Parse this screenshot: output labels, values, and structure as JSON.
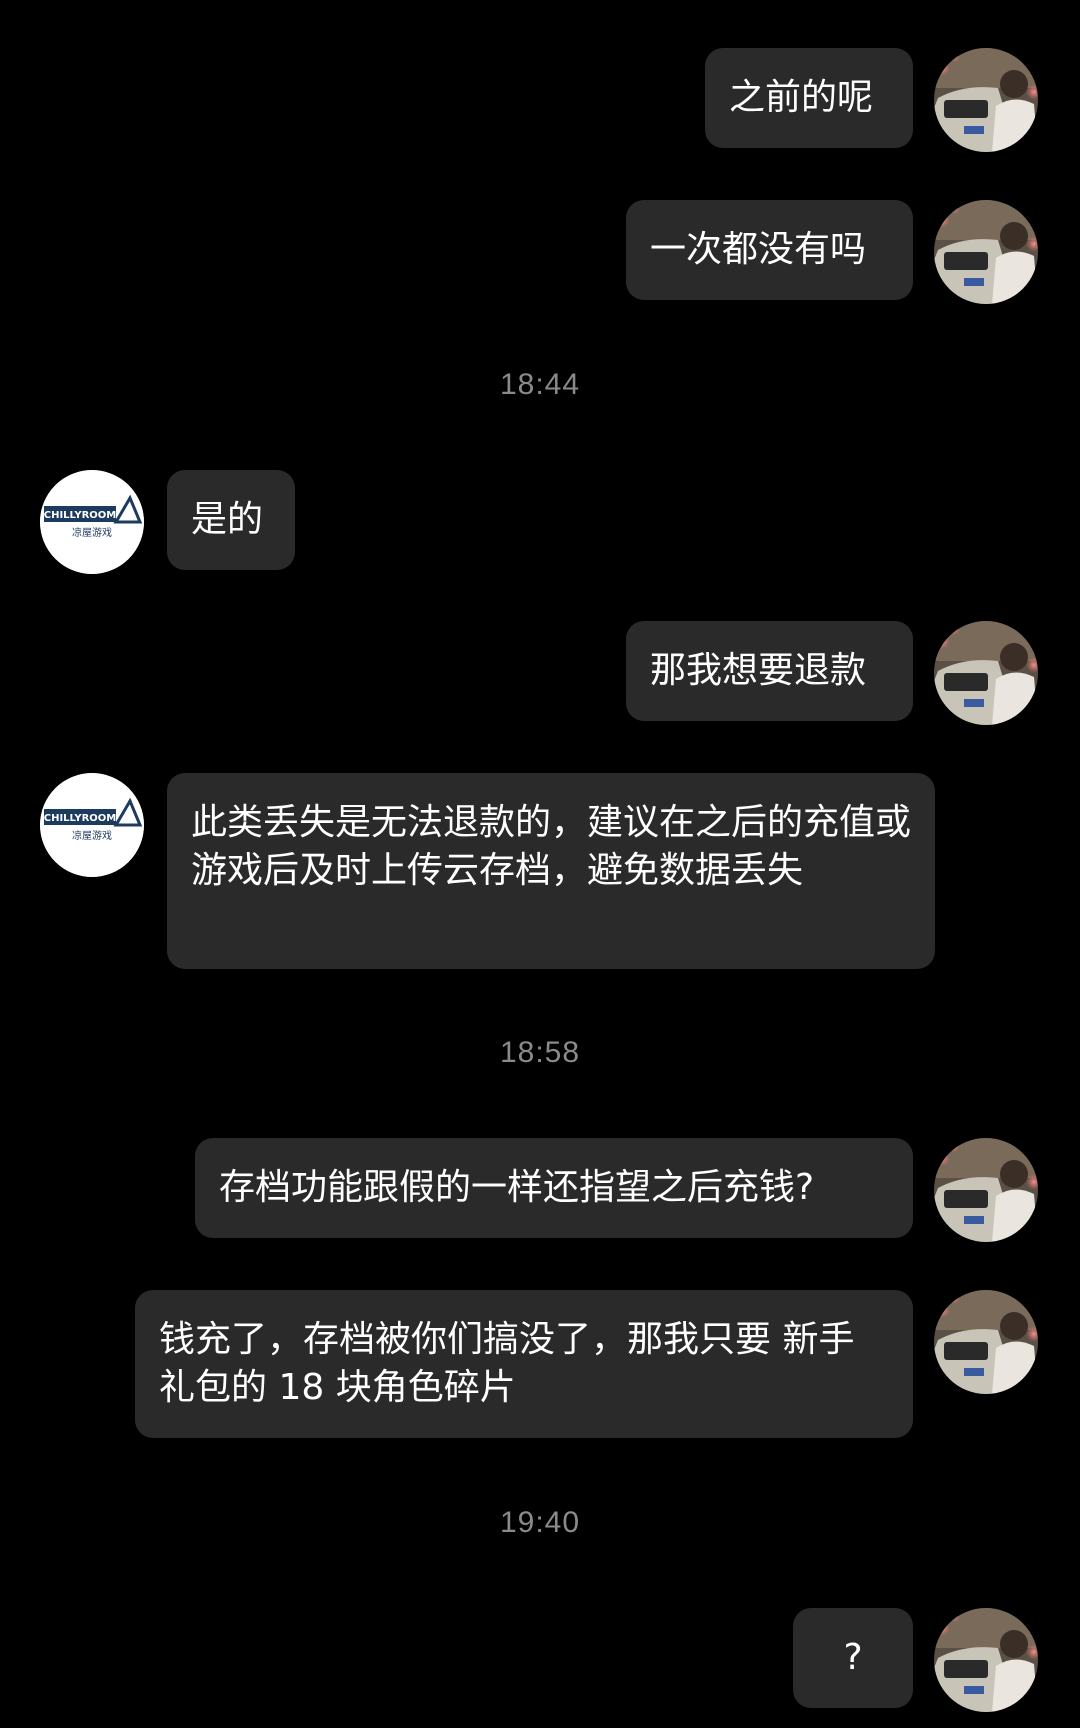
{
  "colors": {
    "background": "#000000",
    "bubble": "#2a2a2a",
    "text": "#ffffff",
    "timestamp": "#8a8a8a",
    "support_logo_navy": "#1d3a5f"
  },
  "avatars": {
    "user_icon": "user-photo-avatar",
    "support_icon": "chillyroom-logo-avatar",
    "support_logo_text": "CHILLYROOM",
    "support_logo_subtext": "凉屋游戏"
  },
  "messages": [
    {
      "sender": "user",
      "text": "之前的呢"
    },
    {
      "sender": "user",
      "text": "一次都没有吗"
    },
    {
      "type": "time",
      "text": "18:44"
    },
    {
      "sender": "support",
      "text": "是的"
    },
    {
      "sender": "user",
      "text": "那我想要退款"
    },
    {
      "sender": "support",
      "text": "此类丢失是无法退款的，建议在之后的充值或游戏后及时上传云存档，避免数据丢失"
    },
    {
      "type": "time",
      "text": "18:58"
    },
    {
      "sender": "user",
      "text": "存档功能跟假的一样还指望之后充钱?"
    },
    {
      "sender": "user",
      "text": "钱充了，存档被你们搞没了，那我只要 新手礼包的 18 块角色碎片"
    },
    {
      "type": "time",
      "text": "19:40"
    },
    {
      "sender": "user",
      "text": "?"
    }
  ]
}
